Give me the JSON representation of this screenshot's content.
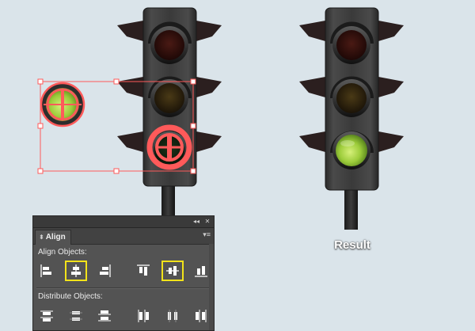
{
  "result_label": "Result",
  "panel": {
    "collapse_glyph": "◂◂",
    "close_glyph": "✕",
    "tab_label": "Align",
    "tab_arrows": "⬍",
    "menu_glyph": "▾≡",
    "align_objects_label": "Align Objects:",
    "distribute_objects_label": "Distribute Objects:",
    "align_buttons": [
      {
        "name": "align-left-icon",
        "highlighted": false
      },
      {
        "name": "align-horizontal-center-icon",
        "highlighted": true
      },
      {
        "name": "align-right-icon",
        "highlighted": false
      },
      {
        "name": "align-top-icon",
        "highlighted": false
      },
      {
        "name": "align-vertical-center-icon",
        "highlighted": true
      },
      {
        "name": "align-bottom-icon",
        "highlighted": false
      }
    ],
    "distribute_buttons": [
      {
        "name": "distribute-top-icon"
      },
      {
        "name": "distribute-vertical-center-icon"
      },
      {
        "name": "distribute-bottom-icon"
      },
      {
        "name": "distribute-left-icon"
      },
      {
        "name": "distribute-horizontal-center-icon"
      },
      {
        "name": "distribute-right-icon"
      }
    ]
  },
  "colors": {
    "background": "#dae4ea",
    "selection": "#ff5a5a",
    "highlight": "#f2e31a",
    "light_green": "#9ccc3a",
    "light_off_red": "#3a1210",
    "light_off_amber": "#2e2410"
  }
}
